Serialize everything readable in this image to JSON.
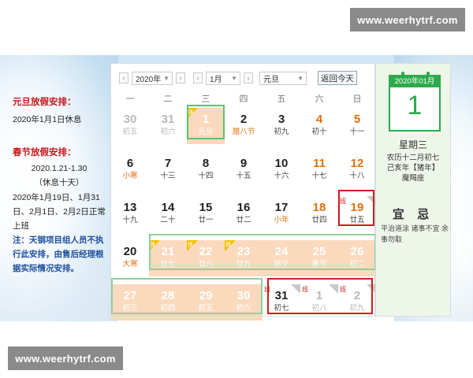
{
  "watermark": "www.weerhytrf.com",
  "notes": {
    "newyear_title": "元旦放假安排：",
    "newyear_date": "2020年1月1日休息",
    "spring_title": "春节放假安排：",
    "spring_range": "2020.1.21-1.30",
    "spring_days": "（休息十天）",
    "workdays": "2020年1月19日、1月31日、2月1日、2月2日正常上班",
    "note": "注：天钢项目组人员不执行此安排，由售后经理根据实际情况安排。"
  },
  "toolbar": {
    "year": "2020年",
    "month": "1月",
    "holiday": "元旦",
    "today_button": "返回今天",
    "prev": "‹",
    "next": "›"
  },
  "weekdays": [
    "一",
    "二",
    "三",
    "四",
    "五",
    "六",
    "日"
  ],
  "markers": {
    "rest": "休",
    "work": "班"
  },
  "days": [
    {
      "n": "30",
      "l": "初五",
      "other": true
    },
    {
      "n": "31",
      "l": "初六",
      "other": true
    },
    {
      "n": "1",
      "l": "元旦",
      "hol": true,
      "rest": true
    },
    {
      "n": "2",
      "l": "腊八节",
      "fest": true
    },
    {
      "n": "3",
      "l": "初九"
    },
    {
      "n": "4",
      "l": "初十",
      "wk": true
    },
    {
      "n": "5",
      "l": "十一",
      "wk": true
    },
    {
      "n": "6",
      "l": "小寒",
      "fest": true
    },
    {
      "n": "7",
      "l": "十三"
    },
    {
      "n": "8",
      "l": "十四"
    },
    {
      "n": "9",
      "l": "十五"
    },
    {
      "n": "10",
      "l": "十六"
    },
    {
      "n": "11",
      "l": "十七",
      "wk": true
    },
    {
      "n": "12",
      "l": "十八",
      "wk": true
    },
    {
      "n": "13",
      "l": "十九"
    },
    {
      "n": "14",
      "l": "二十"
    },
    {
      "n": "15",
      "l": "廿一"
    },
    {
      "n": "16",
      "l": "廿二"
    },
    {
      "n": "17",
      "l": "小年",
      "fest": true
    },
    {
      "n": "18",
      "l": "廿四",
      "wk": true
    },
    {
      "n": "19",
      "l": "廿五",
      "wk": true,
      "ban": true
    },
    {
      "n": "20",
      "l": "大寒",
      "fest": true
    },
    {
      "n": "21",
      "l": "廿七",
      "hol": true,
      "rest": true
    },
    {
      "n": "22",
      "l": "廿八",
      "hol": true,
      "rest": true
    },
    {
      "n": "23",
      "l": "廿九",
      "hol": true,
      "rest": true
    },
    {
      "n": "24",
      "l": "除夕",
      "hol": true
    },
    {
      "n": "25",
      "l": "春节",
      "hol": true
    },
    {
      "n": "26",
      "l": "初二",
      "hol": true
    },
    {
      "n": "27",
      "l": "初三",
      "hol": true
    },
    {
      "n": "28",
      "l": "初四",
      "hol": true
    },
    {
      "n": "29",
      "l": "初五",
      "hol": true
    },
    {
      "n": "30",
      "l": "初六",
      "hol": true
    },
    {
      "n": "31",
      "l": "初七",
      "ban": true
    },
    {
      "n": "1",
      "l": "初八",
      "other": true,
      "ban": true
    },
    {
      "n": "2",
      "l": "初九",
      "other": true,
      "ban": true
    }
  ],
  "side": {
    "header": "2020年01月",
    "day": "1",
    "weekday": "星期三",
    "lunar": "农历十二月初七",
    "ganzhi": "己亥年【猪年】",
    "zodiac": "魔羯座",
    "yi_ji": "宜  忌",
    "yiji_text": "平治道涂 诸事不宜 余事勿取"
  }
}
